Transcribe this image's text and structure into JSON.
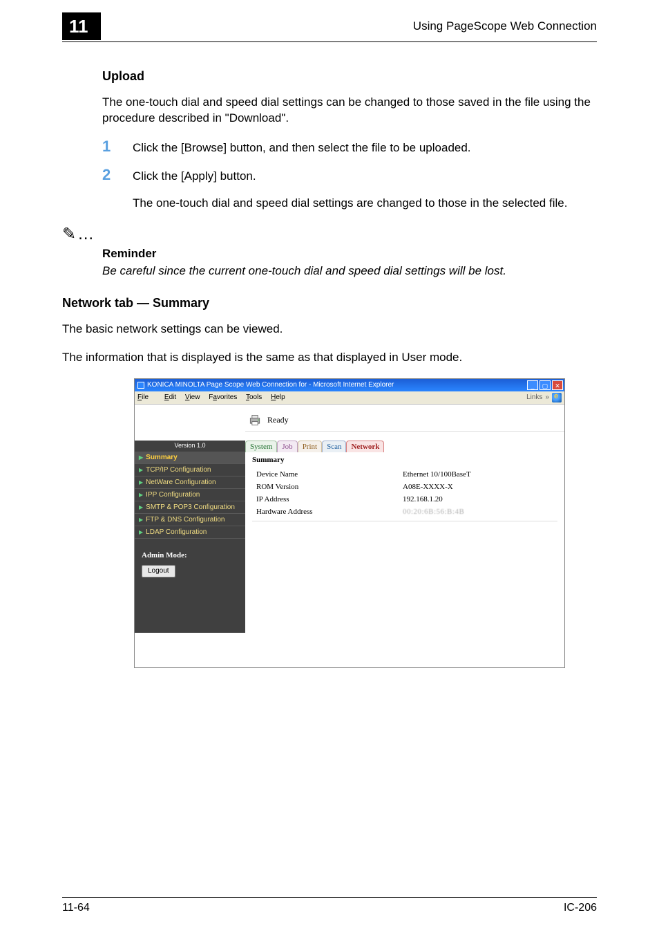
{
  "header": {
    "chapter": "11",
    "running_head": "Using PageScope Web Connection"
  },
  "section_upload": {
    "title": "Upload",
    "intro": "The one-touch dial and speed dial settings can be changed to those saved in the file using the procedure described in \"Download\".",
    "steps": [
      {
        "num": "1",
        "text": "Click the [Browse] button, and then select the file to be uploaded."
      },
      {
        "num": "2",
        "text": "Click the [Apply] button."
      }
    ],
    "step2_extra": "The one-touch dial and speed dial settings are changed to those in the selected file.",
    "note_icon": "✎…",
    "note_title": "Reminder",
    "note_body": "Be careful since the current one-touch dial and speed dial settings will be lost."
  },
  "section_network": {
    "title": "Network tab — Summary",
    "p1": "The basic network settings can be viewed.",
    "p2": "The information that is displayed is the same as that displayed in User mode."
  },
  "screenshot": {
    "window_title": "KONICA MINOLTA Page Scope Web Connection for       - Microsoft Internet Explorer",
    "menubar": {
      "file": "File",
      "edit": "Edit",
      "view": "View",
      "favorites": "Favorites",
      "tools": "Tools",
      "help": "Help",
      "links": "Links"
    },
    "status_ready": "Ready",
    "tabs": {
      "system": "System",
      "job": "Job",
      "print": "Print",
      "scan": "Scan",
      "network": "Network"
    },
    "version": "Version 1.0",
    "sidebar": [
      {
        "label": "Summary",
        "active": true
      },
      {
        "label": "TCP/IP Configuration",
        "active": false
      },
      {
        "label": "NetWare Configuration",
        "active": false
      },
      {
        "label": "IPP Configuration",
        "active": false
      },
      {
        "label": "SMTP & POP3 Configuration",
        "active": false
      },
      {
        "label": "FTP & DNS Configuration",
        "active": false
      },
      {
        "label": "LDAP Configuration",
        "active": false
      }
    ],
    "admin_mode": "Admin Mode:",
    "logout": "Logout",
    "panel_title": "Summary",
    "table": [
      {
        "k": "Device Name",
        "v": "Ethernet 10/100BaseT"
      },
      {
        "k": "ROM Version",
        "v": "A08E-XXXX-X"
      },
      {
        "k": "IP Address",
        "v": "192.168.1.20"
      },
      {
        "k": "Hardware Address",
        "v": "00:20:6B:56:B:4B"
      }
    ]
  },
  "footer": {
    "left": "11-64",
    "right": "IC-206"
  }
}
